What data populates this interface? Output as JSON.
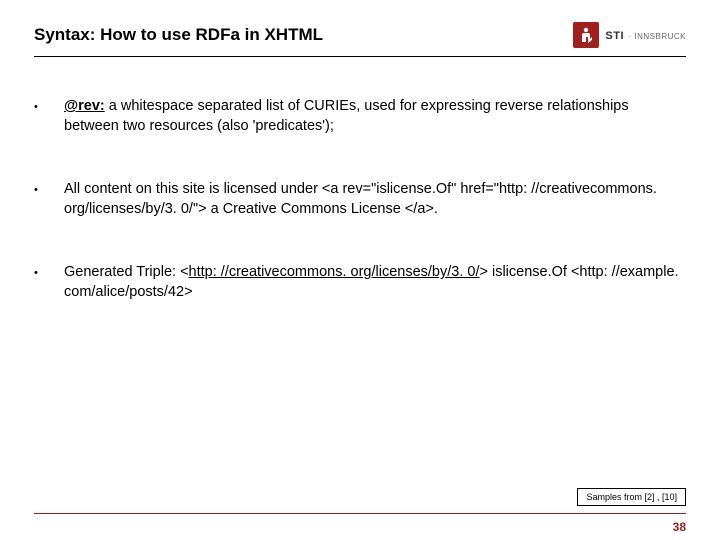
{
  "header": {
    "title": "Syntax: How to use RDFa in XHTML",
    "brand": "STI",
    "brand_sub": "· INNSBRUCK"
  },
  "bullets": [
    {
      "lead_label": "@rev:",
      "lead_rest": " a whitespace separated list of CURIEs, used for expressing reverse relationships between two resources (also 'predicates');"
    },
    {
      "text": "All content on this site is licensed under <a rev=\"islicense.Of\" href=\"http: //creativecommons. org/licenses/by/3. 0/\"> a Creative Commons License </a>."
    },
    {
      "pre": "Generated Triple: <",
      "link": "http: //creativecommons. org/licenses/by/3. 0/",
      "post": "> islicense.Of <http: //example. com/alice/posts/42>"
    }
  ],
  "footer": {
    "samples": "Samples from [2] , [10]",
    "page": "38"
  },
  "colors": {
    "accent": "#a02020"
  }
}
